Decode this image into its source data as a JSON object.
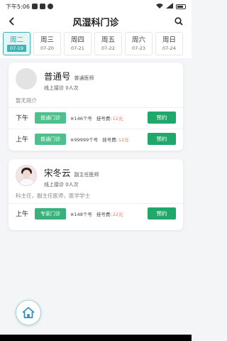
{
  "status_bar": {
    "time": "下午5:06"
  },
  "header": {
    "title": "风湿科门诊"
  },
  "days": [
    {
      "name": "周二",
      "date": "07-19",
      "active": true
    },
    {
      "name": "周三",
      "date": "07-20",
      "active": false
    },
    {
      "name": "周四",
      "date": "07-21",
      "active": false
    },
    {
      "name": "周五",
      "date": "07-22",
      "active": false
    },
    {
      "name": "周六",
      "date": "07-23",
      "active": false
    },
    {
      "name": "周日",
      "date": "07-24",
      "active": false
    }
  ],
  "doctors": [
    {
      "name": "普通号",
      "title": "普通医师",
      "consult": "线上接诊 0人次",
      "intro": "暂无简介",
      "slots": [
        {
          "period": "下午",
          "type": "普通门诊",
          "number": "※146个号",
          "fee_label": "挂号费:",
          "fee": "12元",
          "book": "预约"
        },
        {
          "period": "上午",
          "type": "普通门诊",
          "number": "※99999个号",
          "fee_label": "挂号费:",
          "fee": "12元",
          "book": "预约"
        }
      ]
    },
    {
      "name": "宋冬云",
      "title": "副主任医师",
      "consult": "线上接诊 0人次",
      "intro": "科主任，副主任医师，医学学士",
      "slots": [
        {
          "period": "上午",
          "type": "专家门诊",
          "number": "※148个号",
          "fee_label": "挂号费:",
          "fee": "22元",
          "book": "预约"
        }
      ]
    }
  ],
  "colors": {
    "accent": "#3fb3b3",
    "tag": "#4fc08d",
    "book": "#1fa86a",
    "fee": "#e57a5a"
  }
}
